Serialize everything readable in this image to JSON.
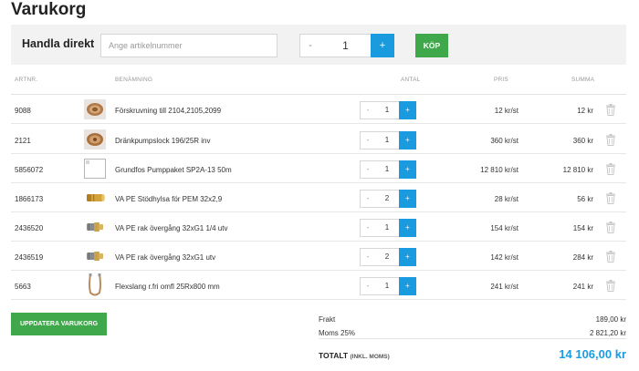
{
  "page": {
    "title": "Varukorg"
  },
  "quick_order": {
    "label": "Handla direkt",
    "placeholder": "Ange artikelnummer",
    "minus": "-",
    "quantity": "1",
    "plus": "+",
    "buy_label": "KÖP"
  },
  "table": {
    "headers": {
      "art": "ARTNR.",
      "name": "BENÄMNING",
      "qty": "ANTAL",
      "price": "PRIS",
      "sum": "SUMMA"
    },
    "rows": [
      {
        "art": "9088",
        "name": "Förskruvning till 2104,2105,2099",
        "qty": "1",
        "price": "12 kr/st",
        "sum": "12 kr",
        "image": "fitting-cap-icon"
      },
      {
        "art": "2121",
        "name": "Dränkpumpslock 196/25R inv",
        "qty": "1",
        "price": "360 kr/st",
        "sum": "360 kr",
        "image": "pump-cap-icon"
      },
      {
        "art": "5856072",
        "name": "Grundfos Pumppaket SP2A-13 50m",
        "qty": "1",
        "price": "12 810 kr/st",
        "sum": "12 810 kr",
        "image": "broken-image-icon"
      },
      {
        "art": "1866173",
        "name": "VA PE Stödhylsa för PEM 32x2,9",
        "qty": "2",
        "price": "28 kr/st",
        "sum": "56 kr",
        "image": "brass-sleeve-icon"
      },
      {
        "art": "2436520",
        "name": "VA PE rak övergång 32xG1 1/4 utv",
        "qty": "1",
        "price": "154 kr/st",
        "sum": "154 kr",
        "image": "pipe-coupling-icon"
      },
      {
        "art": "2436519",
        "name": "VA PE rak övergång 32xG1 utv",
        "qty": "2",
        "price": "142 kr/st",
        "sum": "284 kr",
        "image": "pipe-coupling-icon"
      },
      {
        "art": "5663",
        "name": "Flexslang r.fri omfl 25Rx800 mm",
        "qty": "1",
        "price": "241 kr/st",
        "sum": "241 kr",
        "image": "flex-hose-icon"
      }
    ],
    "minus": "-",
    "plus": "+"
  },
  "update_label": "UPPDATERA VARUKORG",
  "totals": {
    "freight_label": "Frakt",
    "freight_value": "189,00 kr",
    "vat_label": "Moms 25%",
    "vat_value": "2 821,20 kr",
    "total_label": "TOTALT",
    "total_note": "(INKL. MOMS)",
    "total_value": "14 106,00 kr"
  },
  "colors": {
    "accent_blue": "#1a9be0",
    "button_green": "#3ea84a"
  }
}
